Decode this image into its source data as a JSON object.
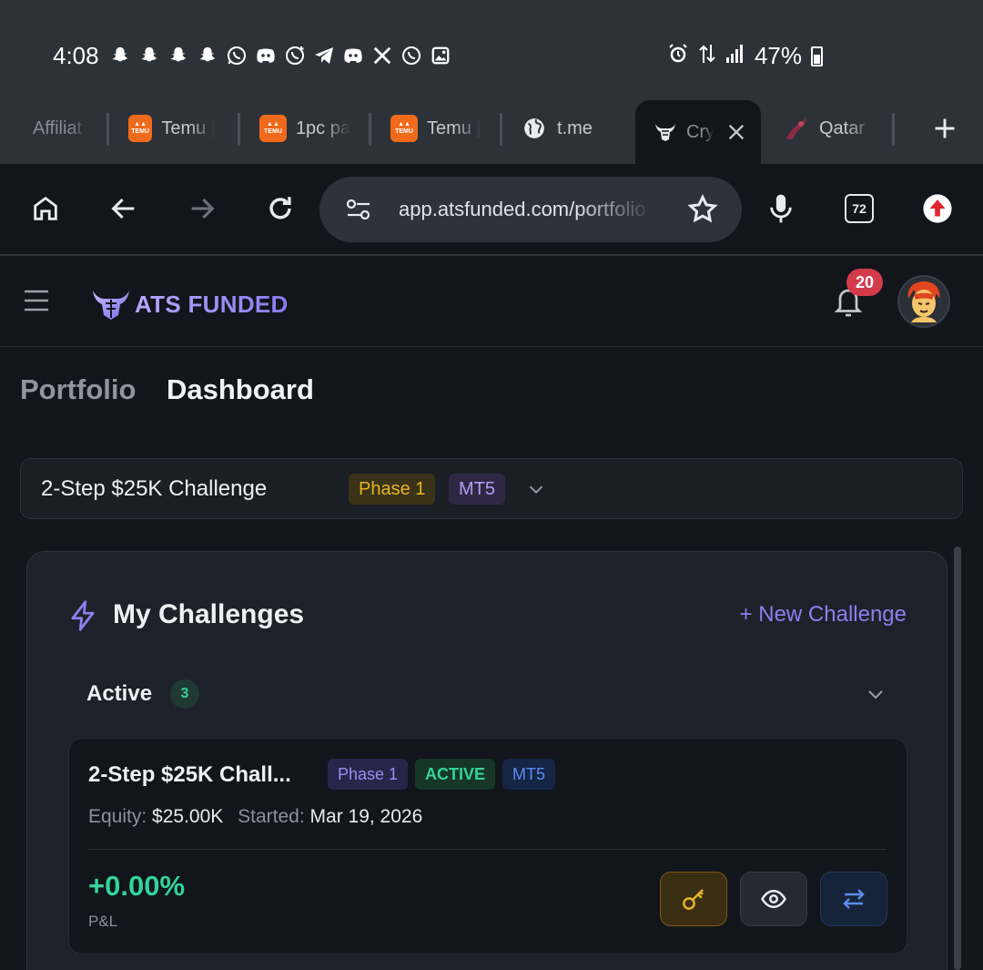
{
  "status_bar": {
    "time": "4:08",
    "battery": "47%",
    "notification_icons": [
      "snapchat-icon",
      "snapchat-icon",
      "snapchat-icon",
      "snapchat-icon",
      "whatsapp-icon",
      "discord-icon",
      "whatsapp-business-icon",
      "telegram-icon",
      "discord-icon",
      "x-icon",
      "whatsapp-icon",
      "gallery-icon"
    ]
  },
  "tabs": [
    {
      "label": "Affiliat",
      "icon": "none"
    },
    {
      "label": "Temu |",
      "icon": "temu-logo"
    },
    {
      "label": "1pc pa",
      "icon": "temu-logo"
    },
    {
      "label": "Temu |",
      "icon": "temu-logo"
    },
    {
      "label": "t.me",
      "icon": "globe-icon"
    },
    {
      "label": "Cry",
      "icon": "ats-logo",
      "active": true
    },
    {
      "label": "Qatar",
      "icon": "airline-icon"
    }
  ],
  "toolbar": {
    "url": "app.atsfunded.com/portfolio",
    "tab_count": "72"
  },
  "app": {
    "brand": "ATS FUNDED",
    "notification_count": "20"
  },
  "breadcrumb": {
    "portfolio": "Portfolio",
    "dashboard": "Dashboard"
  },
  "selector": {
    "title": "2-Step $25K Challenge",
    "phase": "Phase 1",
    "platform": "MT5"
  },
  "challenges": {
    "title": "My Challenges",
    "new_button": "+ New Challenge",
    "active_label": "Active",
    "active_count": "3",
    "item": {
      "title": "2-Step $25K Chall...",
      "phase": "Phase 1",
      "status": "ACTIVE",
      "platform": "MT5",
      "equity_label": "Equity:",
      "equity_value": "$25.00K",
      "started_label": "Started:",
      "started_value": "Mar 19, 2026",
      "pnl_value": "+0.00%",
      "pnl_label": "P&L"
    }
  },
  "colors": {
    "accent_purple": "#8c7ff0",
    "profit_green": "#34d399",
    "phase_yellow": "#e6b422",
    "badge_red": "#d33b4b"
  }
}
